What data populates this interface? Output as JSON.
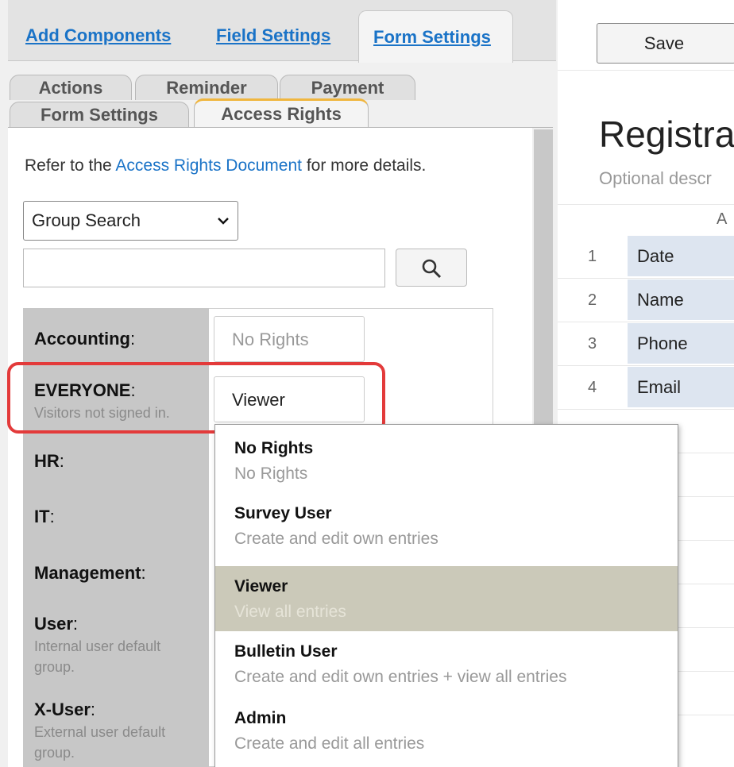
{
  "builder_tabs": {
    "add_components": "Add Components",
    "field_settings": "Field Settings",
    "form_settings": "Form Settings"
  },
  "sub_tabs": {
    "actions": "Actions",
    "reminder": "Reminder",
    "payment": "Payment",
    "form_settings": "Form Settings",
    "access_rights": "Access Rights"
  },
  "info": {
    "prefix": "Refer to the ",
    "link": "Access Rights Document",
    "suffix": " for more details."
  },
  "group_search": {
    "selected": "Group Search",
    "query": ""
  },
  "groups": [
    {
      "name": "Accounting",
      "desc": "",
      "rights": "No Rights"
    },
    {
      "name": "EVERYONE",
      "desc": "Visitors not signed in.",
      "rights": "Viewer"
    },
    {
      "name": "HR",
      "desc": ""
    },
    {
      "name": "IT",
      "desc": ""
    },
    {
      "name": "Management",
      "desc": ""
    },
    {
      "name": "User",
      "desc": "Internal user default group."
    },
    {
      "name": "X-User",
      "desc": "External user default group."
    }
  ],
  "colon": ":",
  "rights_options": [
    {
      "title": "No Rights",
      "desc": "No Rights"
    },
    {
      "title": "Survey User",
      "desc": "Create and edit own entries"
    },
    {
      "title": "Viewer",
      "desc": "View all entries"
    },
    {
      "title": "Bulletin User",
      "desc": "Create and edit own entries + view all entries"
    },
    {
      "title": "Admin",
      "desc": "Create and edit all entries"
    }
  ],
  "selected_option": "Viewer",
  "toolbar": {
    "save_label": "Save"
  },
  "form_preview": {
    "title": "Registra",
    "description": "Optional descr",
    "column_letter": "A",
    "rows": [
      {
        "num": "1",
        "field": "Date"
      },
      {
        "num": "2",
        "field": "Name"
      },
      {
        "num": "3",
        "field": "Phone"
      },
      {
        "num": "4",
        "field": "Email"
      }
    ]
  },
  "colors": {
    "link": "#1a73c7",
    "active_tab_accent": "#f0b63f",
    "highlight": "#e33a3a",
    "selected_option_bg": "#cbc9b9"
  }
}
